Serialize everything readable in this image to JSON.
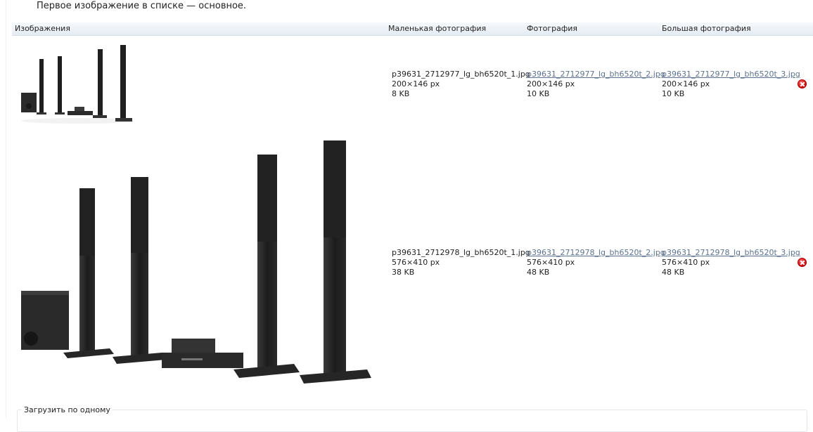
{
  "hint": "Первое изображение в списке — основное.",
  "table": {
    "headers": [
      "Изображения",
      "Маленькая фотография",
      "Фотография",
      "Большая фотография"
    ]
  },
  "rows": [
    {
      "small": {
        "name": "p39631_2712977_lg_bh6520t_1.jpg",
        "dims": "200×146 px",
        "size": "8 KB"
      },
      "photo": {
        "name": "p39631_2712977_lg_bh6520t_2.jpg",
        "dims": "200×146 px",
        "size": "10 KB"
      },
      "large": {
        "name": "p39631_2712977_lg_bh6520t_3.jpg",
        "dims": "200×146 px",
        "size": "10 KB"
      }
    },
    {
      "small": {
        "name": "p39631_2712978_lg_bh6520t_1.jpg",
        "dims": "576×410 px",
        "size": "38 KB"
      },
      "photo": {
        "name": "p39631_2712978_lg_bh6520t_2.jpg",
        "dims": "576×410 px",
        "size": "48 KB"
      },
      "large": {
        "name": "p39631_2712978_lg_bh6520t_3.jpg",
        "dims": "576×410 px",
        "size": "48 KB"
      }
    }
  ],
  "upload_one": "Загрузить по одному",
  "icons": {
    "delete": "delete-icon",
    "accent": "#c80a0a",
    "link": "#5b7290"
  }
}
